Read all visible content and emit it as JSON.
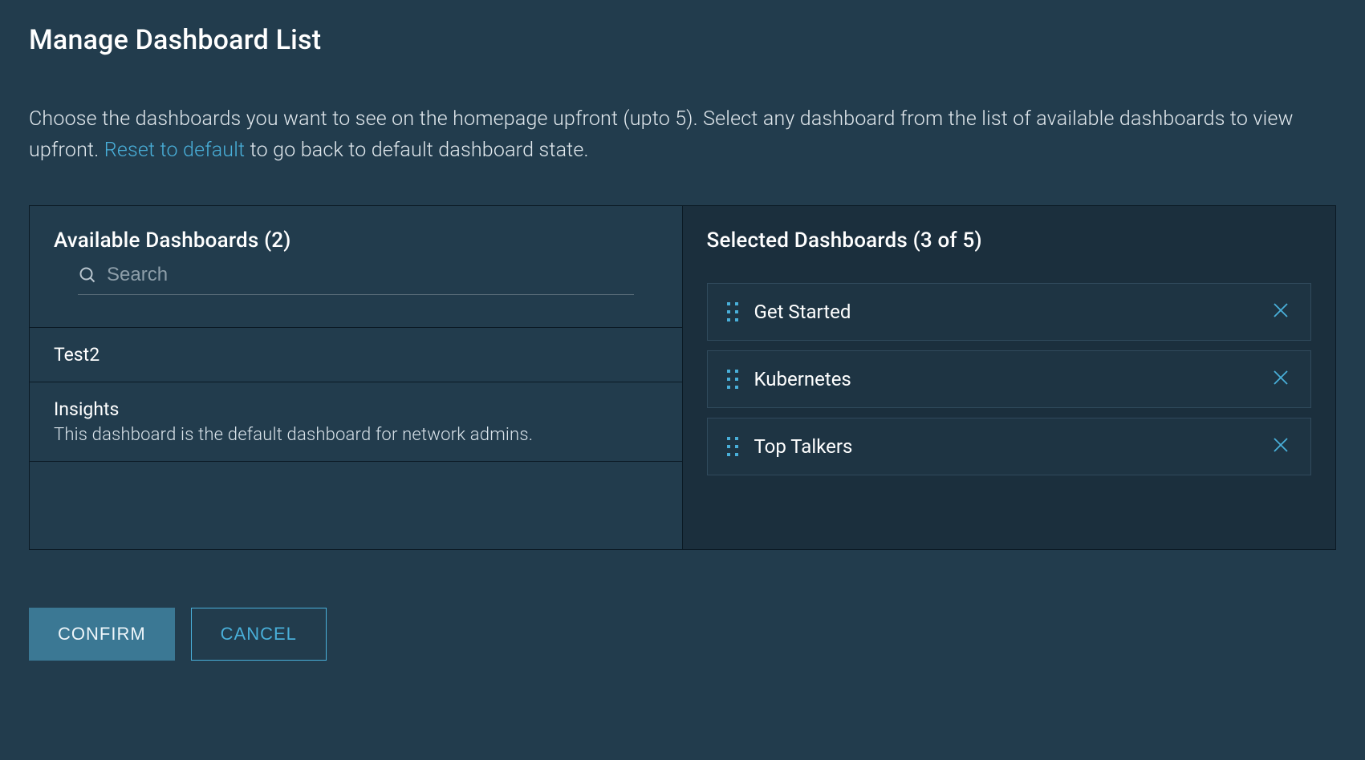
{
  "title": "Manage Dashboard List",
  "description": {
    "part1": "Choose the dashboards you want to see on the homepage upfront (upto 5). Select any dashboard from the list of available dashboards to view upfront. ",
    "reset_link": "Reset to default",
    "part2": " to go back to default dashboard state."
  },
  "available": {
    "heading": "Available Dashboards (2)",
    "search_placeholder": "Search",
    "search_value": "",
    "items": [
      {
        "title": "Test2",
        "description": ""
      },
      {
        "title": "Insights",
        "description": "This dashboard is the default dashboard for network admins."
      }
    ]
  },
  "selected": {
    "heading": "Selected Dashboards (3 of 5)",
    "items": [
      {
        "name": "Get Started"
      },
      {
        "name": "Kubernetes"
      },
      {
        "name": "Top Talkers"
      }
    ]
  },
  "footer": {
    "confirm_label": "CONFIRM",
    "cancel_label": "CANCEL"
  },
  "icons": {
    "search": "search-icon",
    "drag": "drag-handle-icon",
    "close": "close-icon"
  }
}
